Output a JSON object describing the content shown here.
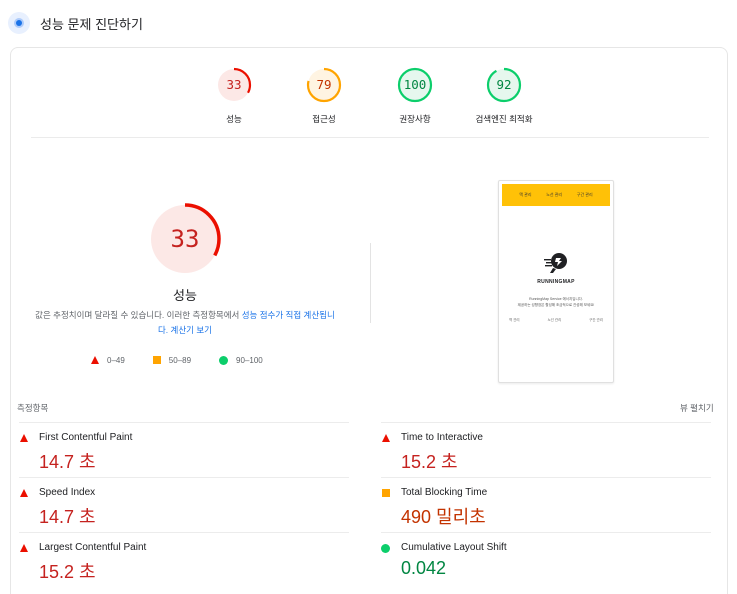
{
  "header": {
    "title": "성능 문제 진단하기"
  },
  "gauges": [
    {
      "score": 33,
      "label": "성능",
      "color": "#eb0f00",
      "bg": "#fce8e6",
      "text_color": "#c5221f"
    },
    {
      "score": 79,
      "label": "접근성",
      "color": "#ffa400",
      "bg": "#fff4e2",
      "text_color": "#c33300"
    },
    {
      "score": 100,
      "label": "권장사항",
      "color": "#0cce6b",
      "bg": "#e6f7ee",
      "text_color": "#018642"
    },
    {
      "score": 92,
      "label": "검색엔진 최적화",
      "color": "#0cce6b",
      "bg": "#e6f7ee",
      "text_color": "#018642"
    }
  ],
  "main_score": {
    "value": "33",
    "label": "성능"
  },
  "note": {
    "text": "값은 추정치이며 달라질 수 있습니다. 이러한 측정항목에서 ",
    "link1": "성능 점수가 직접 계산됩니",
    "link2": "다. 계산기 보기"
  },
  "legend": {
    "fail": "0–49",
    "average": "50–89",
    "pass": "90–100"
  },
  "screenshot": {
    "nav": [
      "맥 관리",
      "노선 관리",
      "구간 관리"
    ],
    "brand": "RUNNINGMAP",
    "desc1": "RunningMap Service 에서지입니다.",
    "desc2": "제공하는 성향장은 활성해 조금적으로 관성해 보세요!",
    "links": [
      "역 관리",
      "노선 관리",
      "구간 관리"
    ]
  },
  "metrics_section": {
    "title": "측정항목",
    "expand": "뷰 펼치기"
  },
  "metrics": [
    {
      "name": "First Contentful Paint",
      "value": "14.7 초",
      "status": "fail"
    },
    {
      "name": "Time to Interactive",
      "value": "15.2 초",
      "status": "fail"
    },
    {
      "name": "Speed Index",
      "value": "14.7 초",
      "status": "fail"
    },
    {
      "name": "Total Blocking Time",
      "value": "490 밀리초",
      "status": "average"
    },
    {
      "name": "Largest Contentful Paint",
      "value": "15.2 초",
      "status": "fail"
    },
    {
      "name": "Cumulative Layout Shift",
      "value": "0.042",
      "status": "pass"
    }
  ],
  "status_colors": {
    "fail": "#c5221f",
    "average": "#c33300",
    "pass": "#018642"
  }
}
